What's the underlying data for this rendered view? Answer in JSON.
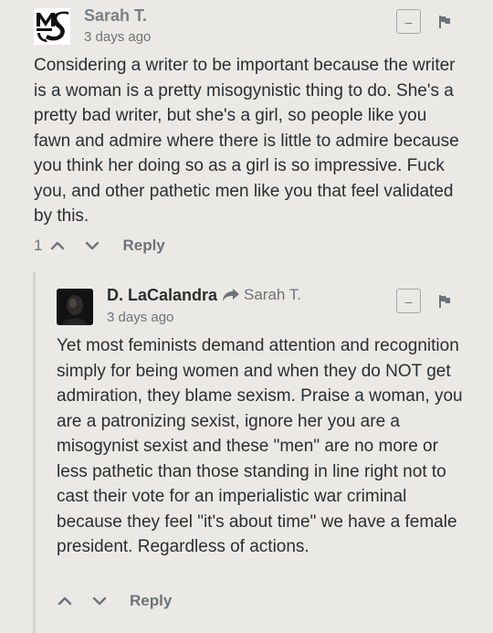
{
  "comments": [
    {
      "author": "Sarah T.",
      "time": "3 days ago",
      "collapse_label": "–",
      "text": "Considering a writer to be important because the writer is a woman is a pretty misogynistic thing to do. She's a pretty bad writer, but she's a girl, so people like you fawn and admire where there is little to admire because you think her doing so as a girl is so impressive. Fuck you, and other pathetic men like you that feel validated by this.",
      "votes": "1",
      "reply_label": "Reply"
    },
    {
      "author": "D. LaCalandra",
      "reply_to": "Sarah T.",
      "time": "3 days ago",
      "collapse_label": "–",
      "text": "Yet most feminists demand attention and recognition simply for being women and when they do NOT get admiration, they blame sexism. Praise a woman, you are a patronizing sexist, ignore her you are a misogynist sexist and these \"men\" are no more or less pathetic than those standing in line right not to cast their vote for an imperialistic war criminal because they feel \"it's about time\" we have a female president. Regardless of actions.",
      "reply_label": "Reply"
    }
  ],
  "colors": {
    "background": "#ebe9e5",
    "text": "#2a2e31",
    "muted": "#6d737a"
  },
  "icons": {
    "avatar1": "ms-logo-icon",
    "flag": "flag-icon",
    "upvote": "chevron-up-icon",
    "downvote": "chevron-down-icon",
    "reply_arrow": "share-arrow-icon"
  }
}
